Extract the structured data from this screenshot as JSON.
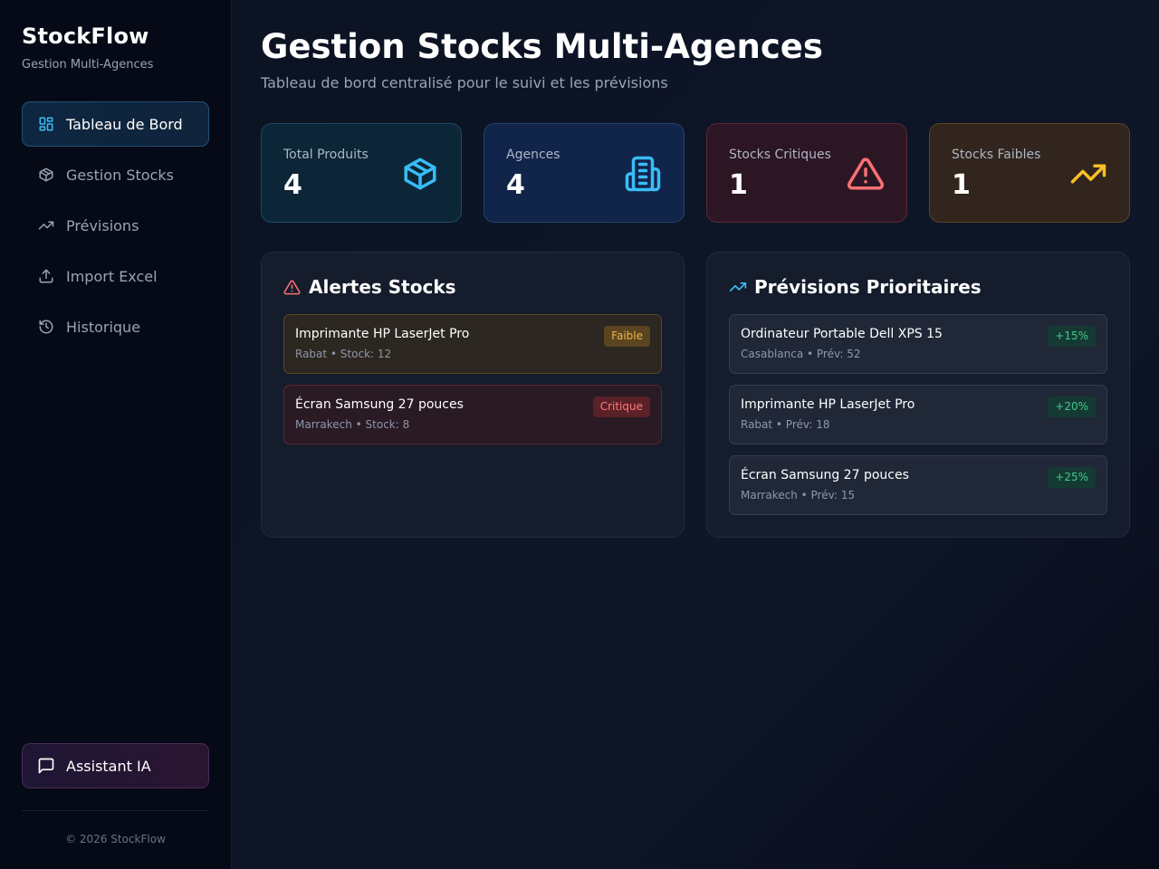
{
  "sidebar": {
    "brand_title": "StockFlow",
    "brand_subtitle": "Gestion Multi-Agences",
    "items": [
      {
        "label": "Tableau de Bord",
        "icon": "dashboard-icon",
        "active": true
      },
      {
        "label": "Gestion Stocks",
        "icon": "package-icon",
        "active": false
      },
      {
        "label": "Prévisions",
        "icon": "trending-up-icon",
        "active": false
      },
      {
        "label": "Import Excel",
        "icon": "upload-icon",
        "active": false
      },
      {
        "label": "Historique",
        "icon": "history-icon",
        "active": false
      }
    ],
    "assistant_label": "Assistant IA",
    "assistant_icon": "chat-icon",
    "copyright": "© 2026 StockFlow"
  },
  "header": {
    "title": "Gestion Stocks Multi-Agences",
    "subtitle": "Tableau de bord centralisé pour le suivi et les prévisions"
  },
  "stats": [
    {
      "label": "Total Produits",
      "value": "4",
      "icon": "box-icon",
      "color": "#38bdf8"
    },
    {
      "label": "Agences",
      "value": "4",
      "icon": "building-icon",
      "color": "#38bdf8"
    },
    {
      "label": "Stocks Critiques",
      "value": "1",
      "icon": "warning-icon",
      "color": "#f87171"
    },
    {
      "label": "Stocks Faibles",
      "value": "1",
      "icon": "trending-up-icon",
      "color": "#fbbf24"
    }
  ],
  "alerts": {
    "title": "Alertes Stocks",
    "icon": "warning-icon",
    "items": [
      {
        "name": "Imprimante HP LaserJet Pro",
        "meta": "Rabat • Stock: 12",
        "badge": "Faible"
      },
      {
        "name": "Écran Samsung 27 pouces",
        "meta": "Marrakech • Stock: 8",
        "badge": "Critique"
      }
    ]
  },
  "forecasts": {
    "title": "Prévisions Prioritaires",
    "icon": "trending-up-icon",
    "items": [
      {
        "name": "Ordinateur Portable Dell XPS 15",
        "meta": "Casablanca • Prév: 52",
        "badge": "+15%"
      },
      {
        "name": "Imprimante HP LaserJet Pro",
        "meta": "Rabat • Prév: 18",
        "badge": "+20%"
      },
      {
        "name": "Écran Samsung 27 pouces",
        "meta": "Marrakech • Prév: 15",
        "badge": "+25%"
      }
    ]
  },
  "colors": {
    "accent": "#38bdf8",
    "danger": "#f87171",
    "warning": "#fbbf24",
    "success": "#3fc98c"
  }
}
